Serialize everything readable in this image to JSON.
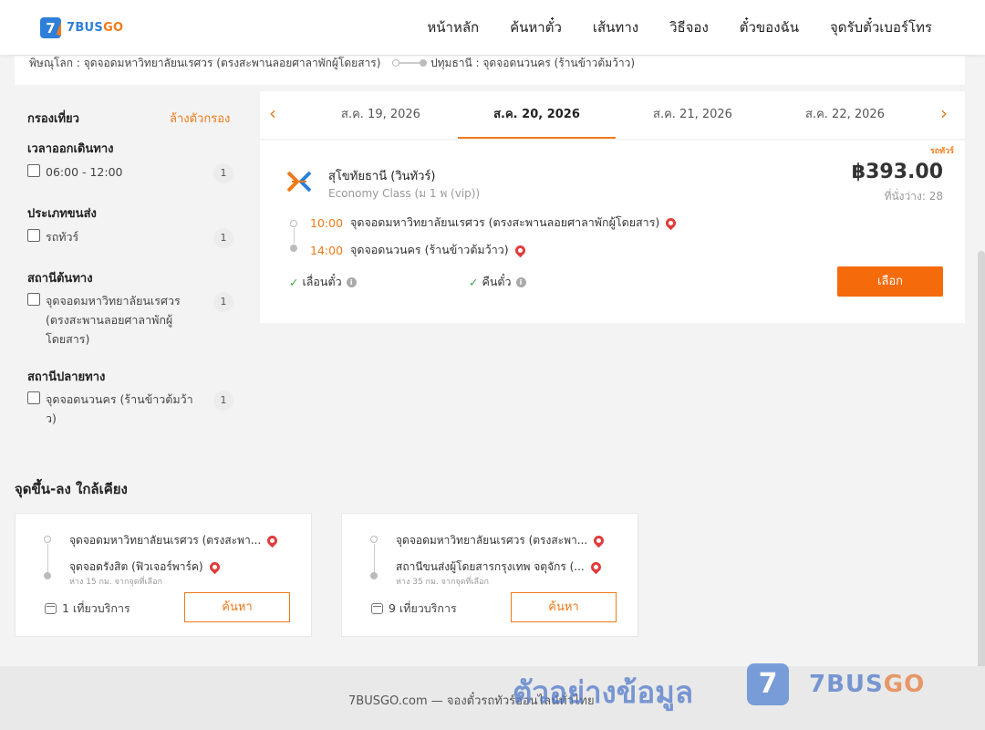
{
  "header": {
    "logo_mark": "7",
    "logo_text_a": "7BUS",
    "logo_text_b": "GO",
    "nav": [
      "หน้าหลัก",
      "ค้นหาตั๋ว",
      "เส้นทาง",
      "วิธีจอง",
      "ตั๋วของฉัน",
      "จุดรับตั๋วเบอร์โทร"
    ]
  },
  "route": {
    "origin": "พิษณุโลก : จุดจอดมหาวิทยาลัยนเรศวร (ตรงสะพานลอยศาลาพักผู้โดยสาร)",
    "destination": "ปทุมธานี : จุดจอดนวนคร (ร้านข้าวต้มว้าว)"
  },
  "filters": {
    "title": "กรองเที่ยว",
    "clear": "ล้างตัวกรอง",
    "groups": [
      {
        "title": "เวลาออกเดินทาง",
        "option": "06:00 - 12:00",
        "count": "1"
      },
      {
        "title": "ประเภทขนส่ง",
        "option": "รถทัวร์",
        "count": "1"
      },
      {
        "title": "สถานีต้นทาง",
        "option": "จุดจอดมหาวิทยาลัยนเรศวร (ตรงสะพานลอยศาลาพักผู้โดยสาร)",
        "count": "1"
      },
      {
        "title": "สถานีปลายทาง",
        "option": "จุดจอดนวนคร (ร้านข้าวต้มว้าว)",
        "count": "1"
      }
    ]
  },
  "dates": {
    "prev_icon": "‹",
    "next_icon": "›",
    "tabs": [
      "ส.ค. 19, 2026",
      "ส.ค. 20, 2026",
      "ส.ค. 21, 2026",
      "ส.ค. 22, 2026"
    ],
    "active_index": 1
  },
  "trip": {
    "tag": "รถทัวร์",
    "operator": "สุโขทัยธานี (วินทัวร์)",
    "class": "Economy Class (ม 1 พ (vip))",
    "price": "฿393.00",
    "seats": "ที่นั่งว่าง: 28",
    "depart_time": "10:00",
    "depart_stop": "จุดจอดมหาวิทยาลัยนเรศวร (ตรงสะพานลอยศาลาพักผู้โดยสาร)",
    "arrive_time": "14:00",
    "arrive_stop": "จุดจอดนวนคร (ร้านข้าวต้มว้าว)",
    "feature_1": "เลื่อนตั๋ว",
    "feature_2": "คืนตั๋ว",
    "select_label": "เลือก",
    "accent_color": "#f56a0b"
  },
  "nearby": {
    "title": "จุดขึ้น-ลง ใกล้เคียง",
    "cards": [
      {
        "from": "จุดจอดมหาวิทยาลัยนเรศวร (ตรงสะพา...",
        "to": "จุดจอดรังสิต (ฟิวเจอร์พาร์ค)",
        "distance": "ห่าง 15 กม. จากจุดที่เลือก",
        "trips": "1 เที่ยวบริการ",
        "button": "ค้นหา"
      },
      {
        "from": "จุดจอดมหาวิทยาลัยนเรศวร (ตรงสะพา...",
        "to": "สถานีขนส่งผู้โดยสารกรุงเทพ จตุจักร (...",
        "distance": "ห่าง 35 กม. จากจุดที่เลือก",
        "trips": "9 เที่ยวบริการ",
        "button": "ค้นหา"
      }
    ]
  },
  "footer": {
    "text": "7BUSGO.com — จองตั๋วรถทัวร์ออนไลน์ทั่วไทย",
    "watermark": "ตัวอย่างข้อมูล",
    "watermark_logo": "7",
    "watermark_brand_a": "7BUS",
    "watermark_brand_b": "GO"
  }
}
